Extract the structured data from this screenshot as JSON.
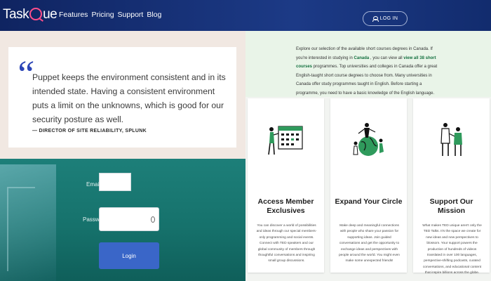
{
  "header": {
    "logo_text": "TaskQue",
    "nav": [
      "Features",
      "Pricing",
      "Support",
      "Blog"
    ],
    "login_label": "LOG IN"
  },
  "testimonial": {
    "quote": "Puppet keeps the environment consistent and in its intended state. Having a consistent environment puts a limit on the unknowns, which is good for our security posture as well.",
    "author": "— DIRECTOR OF SITE RELIABILITY, SPLUNK"
  },
  "login_form": {
    "email_label": "Email",
    "password_label": "Password",
    "submit_label": "Login"
  },
  "intro": {
    "part1": "Explore our selection of the available short courses degrees in Canada. If you're interested in studying in ",
    "link_canada": "Canada",
    "part2": " , you can view all ",
    "link_courses": "view all 38 short courses",
    "part3": " programmes. Top universities and colleges in Canada offer a great English-taught short course degrees to choose from. Many universities in Canada offer study programmes taught in English. Before starting a programme, you need to have a basic knowledge of the English language."
  },
  "cards": [
    {
      "icon": "calendar-illustration",
      "title": "Access Member Exclusives",
      "body": "You can discover a world of possibilities and ideas through our special members-only programming and social events. Connect with TED speakers and our global community of members through thoughtful conversations and inspiring small group discussions."
    },
    {
      "icon": "globe-illustration",
      "title": "Expand Your Circle",
      "body": "Make deep and meaningful connections with people who share your passion for supporting ideas. Join guided conversations and get the opportunity to exchange ideas and perspectives with people around the world. You might even make some unexpected friends!"
    },
    {
      "icon": "people-illustration",
      "title": "Support Our Mission",
      "body": "What makes TED unique aren't only the TED Talks. It's the space we create for new ideas and new perspectives to blossom. Your support powers the production of hundreds of videos translated in over 100 languages, perspective-shifting podcasts, curated conversations, and educational content that inspire billions across the globe."
    }
  ],
  "colors": {
    "header_bg": "#0f2461",
    "accent_pink": "#ff4f8b",
    "quote_mark": "#2b45b7",
    "login_bg": "#16726c",
    "button_blue": "#3a66c8",
    "link_green": "#13703f"
  }
}
